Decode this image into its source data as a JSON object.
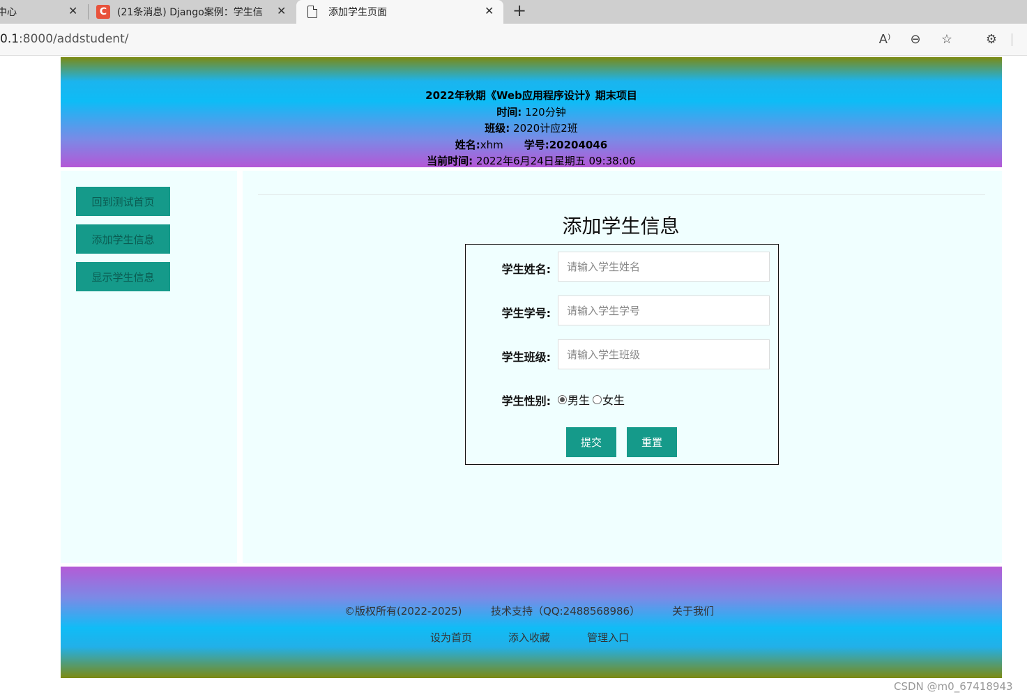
{
  "browser": {
    "tabs": [
      {
        "label": "中心",
        "close": "✕"
      },
      {
        "label": "(21条消息) Django案例：学生信",
        "favicon": "C",
        "close": "✕"
      },
      {
        "label": "添加学生页面",
        "close": "✕"
      }
    ],
    "new_tab": "+",
    "url_prefix": "0.1",
    "url_rest": ":8000/addstudent/",
    "tools": {
      "read_aloud": "A⁾",
      "zoom": "⊖",
      "favorite": "☆",
      "extensions": "⚙"
    }
  },
  "header": {
    "title": "2022年秋期《Web应用程序设计》期末项目",
    "time_label": "时间:",
    "time_value": "120分钟",
    "class_label": "班级:",
    "class_value": "2020计应2班",
    "name_label": "姓名:",
    "name_value": "xhm",
    "id_label": "学号:",
    "id_value": "20204046",
    "now_label": "当前时间:",
    "now_value": "2022年6月24日星期五 09:38:06"
  },
  "sidebar": {
    "items": [
      {
        "label": "回到测试首页"
      },
      {
        "label": "添加学生信息"
      },
      {
        "label": "显示学生信息"
      }
    ]
  },
  "form": {
    "title": "添加学生信息",
    "name_label": "学生姓名:",
    "name_placeholder": "请输入学生姓名",
    "id_label": "学生学号:",
    "id_placeholder": "请输入学生学号",
    "class_label": "学生班级:",
    "class_placeholder": "请输入学生班级",
    "gender_label": "学生性别:",
    "gender_male": "男生",
    "gender_female": "女生",
    "submit_label": "提交",
    "reset_label": "重置"
  },
  "footer": {
    "copyright": "©版权所有(2022-2025)",
    "support": "技术支持（QQ:2488568986）",
    "about": "关于我们",
    "set_home": "设为首页",
    "add_favorite": "添入收藏",
    "admin": "管理入口"
  },
  "watermark": "CSDN @m0_67418943"
}
